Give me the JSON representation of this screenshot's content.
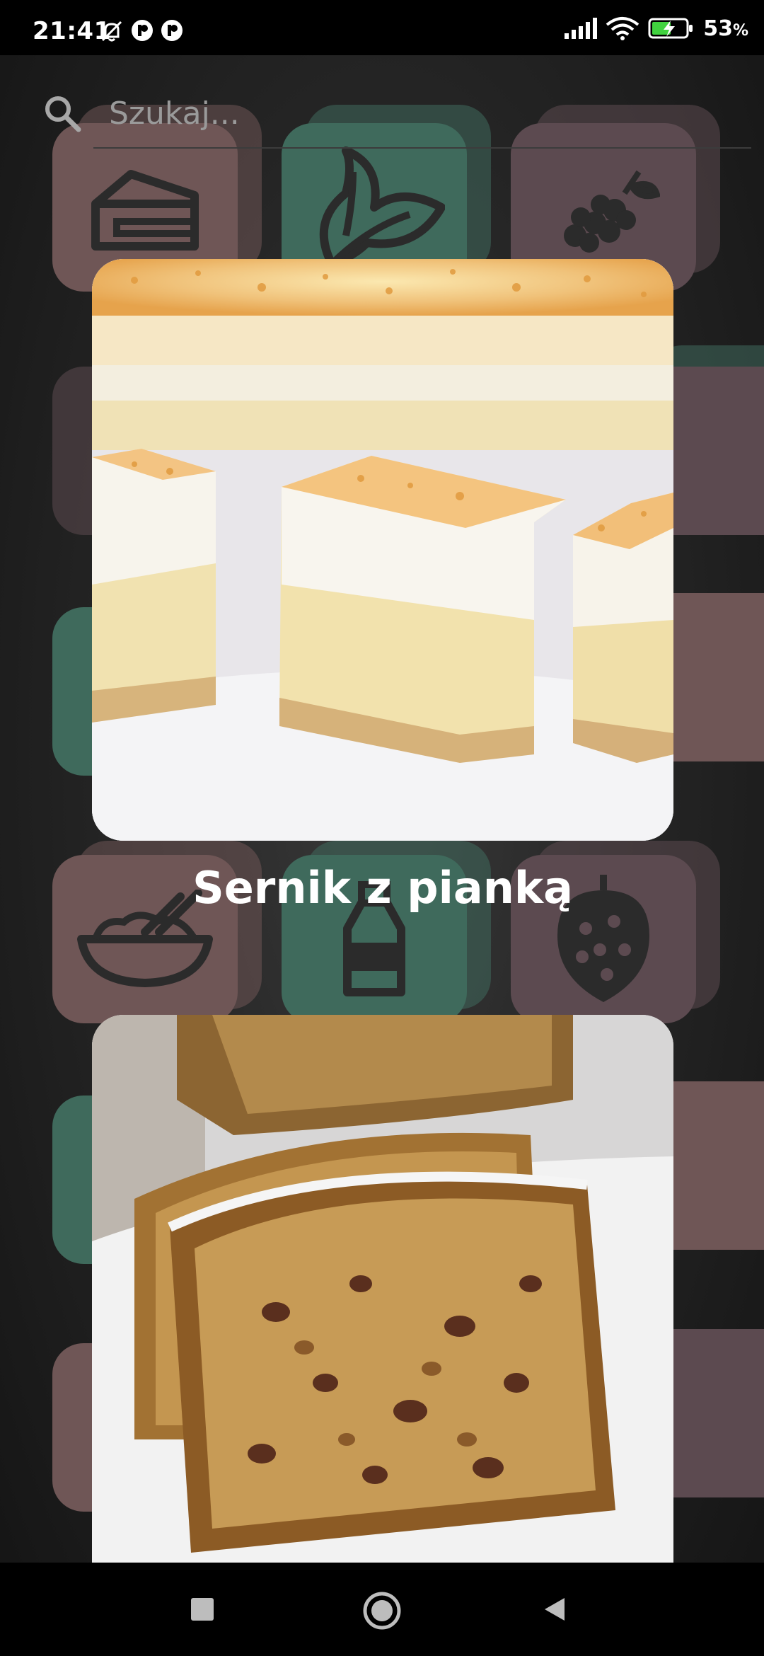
{
  "status_bar": {
    "time": "21:41",
    "battery_percent": "53",
    "battery_unit": "%"
  },
  "search": {
    "placeholder": "Szukaj..."
  },
  "recipes": [
    {
      "title": "Sernik z pianką"
    },
    {
      "title": ""
    }
  ],
  "colors": {
    "tile_pink": "#6f5656",
    "tile_green": "#3f6a5c",
    "tile_mauve": "#5c4a50",
    "icon_dark": "#2b2b2b",
    "accent_battery": "#41d33f"
  },
  "background_icons": [
    "cake-icon",
    "leaf-icon",
    "grapes-icon",
    "bowl-icon",
    "bottle-icon",
    "raspberry-icon"
  ]
}
